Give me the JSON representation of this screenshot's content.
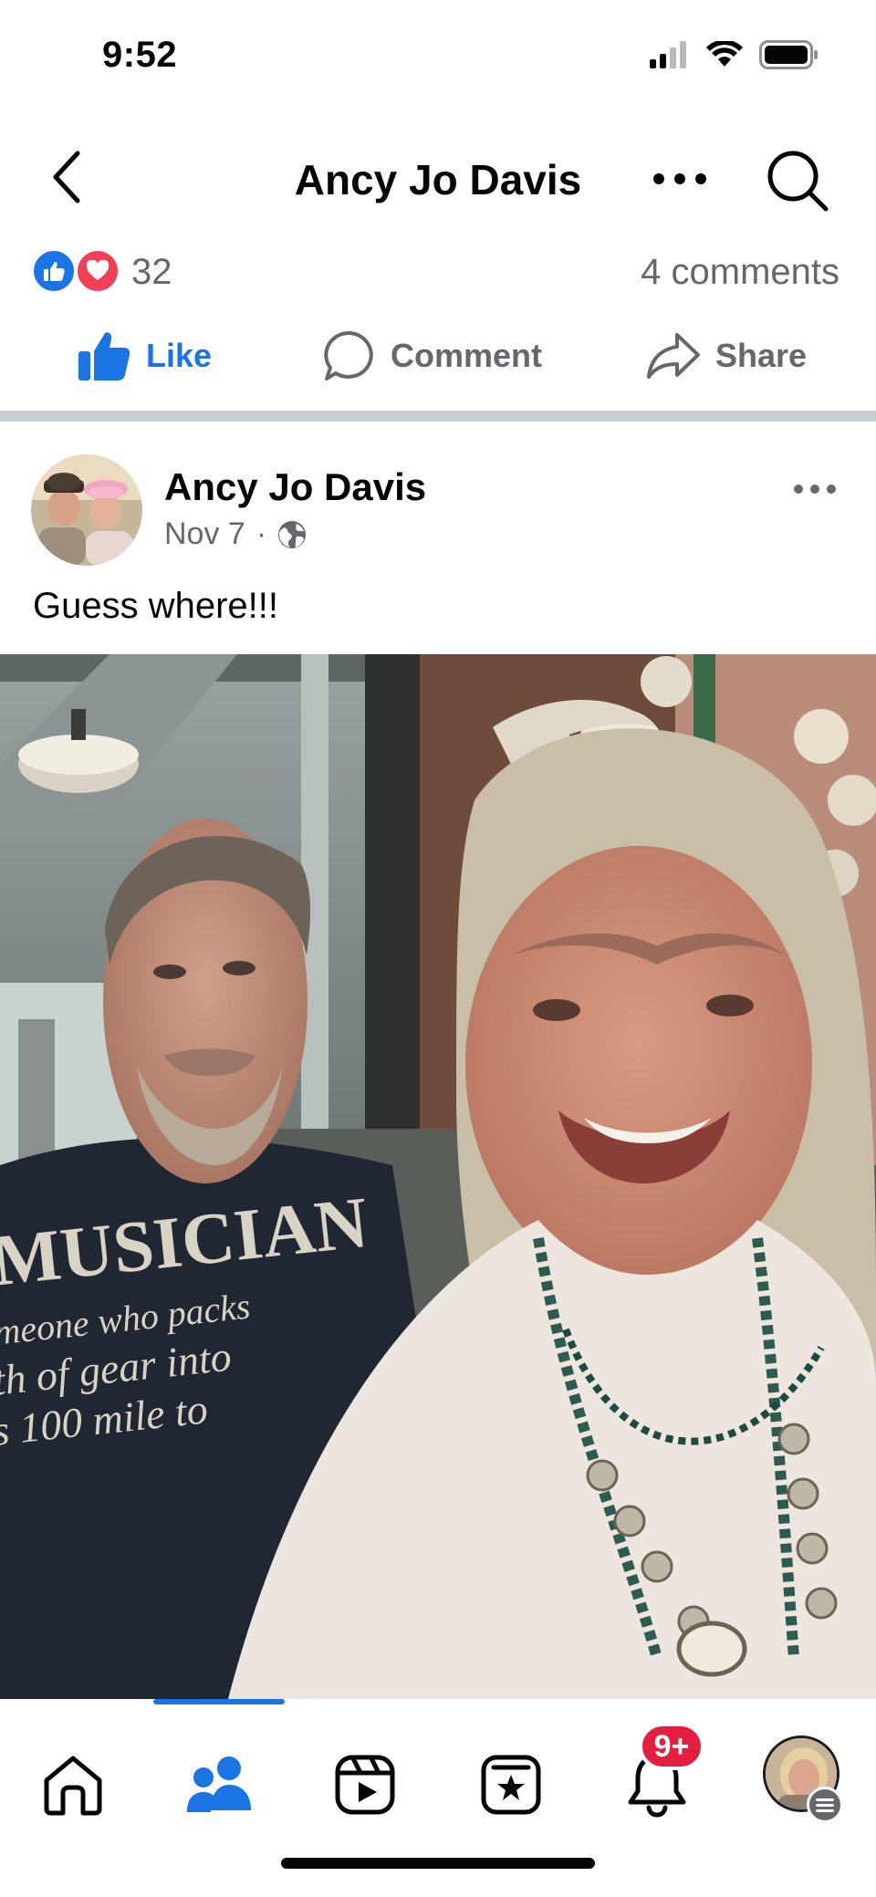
{
  "status_bar": {
    "time": "9:52"
  },
  "nav": {
    "title": "Ancy Jo Davis"
  },
  "reactions": {
    "count": "32",
    "comments": "4 comments"
  },
  "actions": {
    "like": "Like",
    "comment": "Comment",
    "share": "Share"
  },
  "post": {
    "author": "Ancy Jo Davis",
    "date": "Nov 7",
    "separator": "·",
    "text": "Guess where!!!",
    "photo_shirt_text": [
      "MUSICIAN",
      "meone who packs",
      "th of gear into",
      "s 100 mile to"
    ]
  },
  "tab_bar": {
    "notifications_badge": "9+",
    "items": [
      "home-icon",
      "friends-icon",
      "video-icon",
      "marketplace-icon",
      "notifications-icon",
      "profile-avatar"
    ]
  },
  "colors": {
    "accent": "#1b74e4",
    "love": "#f33e58",
    "badge": "#e41e3f",
    "muted": "#65676b",
    "divider": "#c9ccd1"
  }
}
